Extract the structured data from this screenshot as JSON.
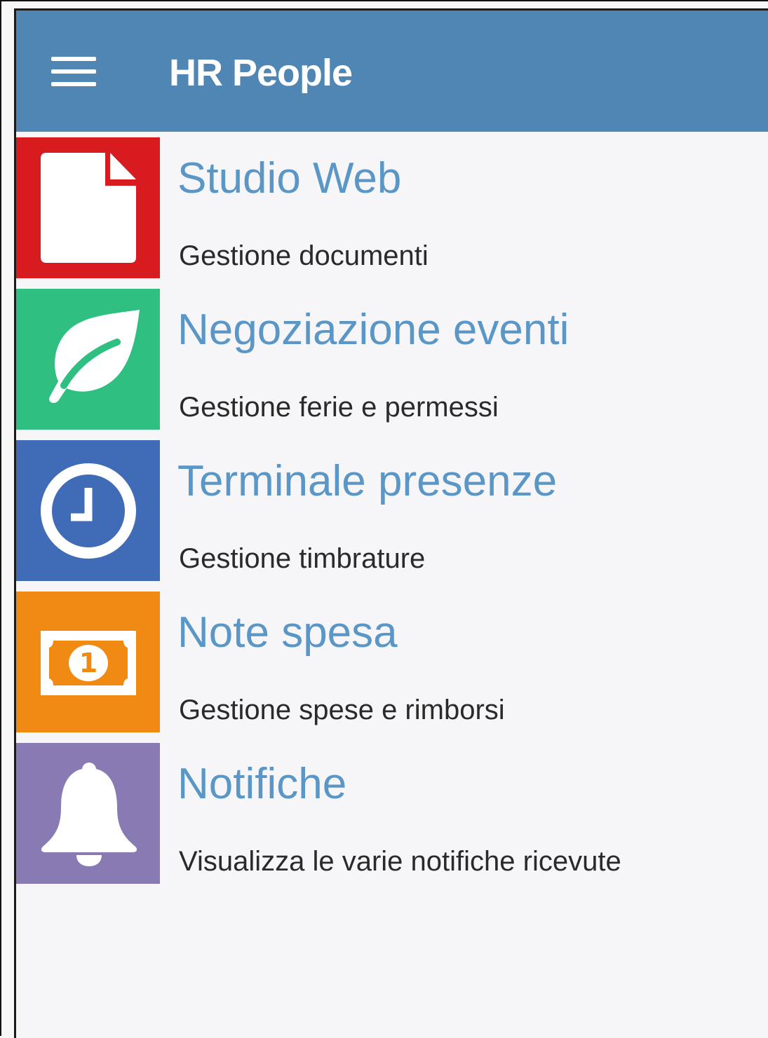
{
  "app": {
    "title": "HR People"
  },
  "colors": {
    "appbar": "#4f86b3",
    "title_text": "#5b97c6",
    "studio_web": "#d71b1f",
    "negoziazione": "#2fbf80",
    "terminale": "#3f6bb7",
    "note_spesa": "#f08a12",
    "notifiche": "#8a7ab3"
  },
  "menu": {
    "icon": "hamburger-menu-icon"
  },
  "items": [
    {
      "title": "Studio Web",
      "subtitle": "Gestione documenti",
      "icon": "document-icon"
    },
    {
      "title": "Negoziazione eventi",
      "subtitle": "Gestione ferie e permessi",
      "icon": "leaf-icon"
    },
    {
      "title": "Terminale presenze",
      "subtitle": "Gestione timbrature",
      "icon": "clock-icon"
    },
    {
      "title": "Note spesa",
      "subtitle": "Gestione spese e rimborsi",
      "icon": "banknote-icon",
      "icon_text": "1"
    },
    {
      "title": "Notifiche",
      "subtitle": "Visualizza le varie notifiche ricevute",
      "icon": "bell-icon"
    }
  ]
}
